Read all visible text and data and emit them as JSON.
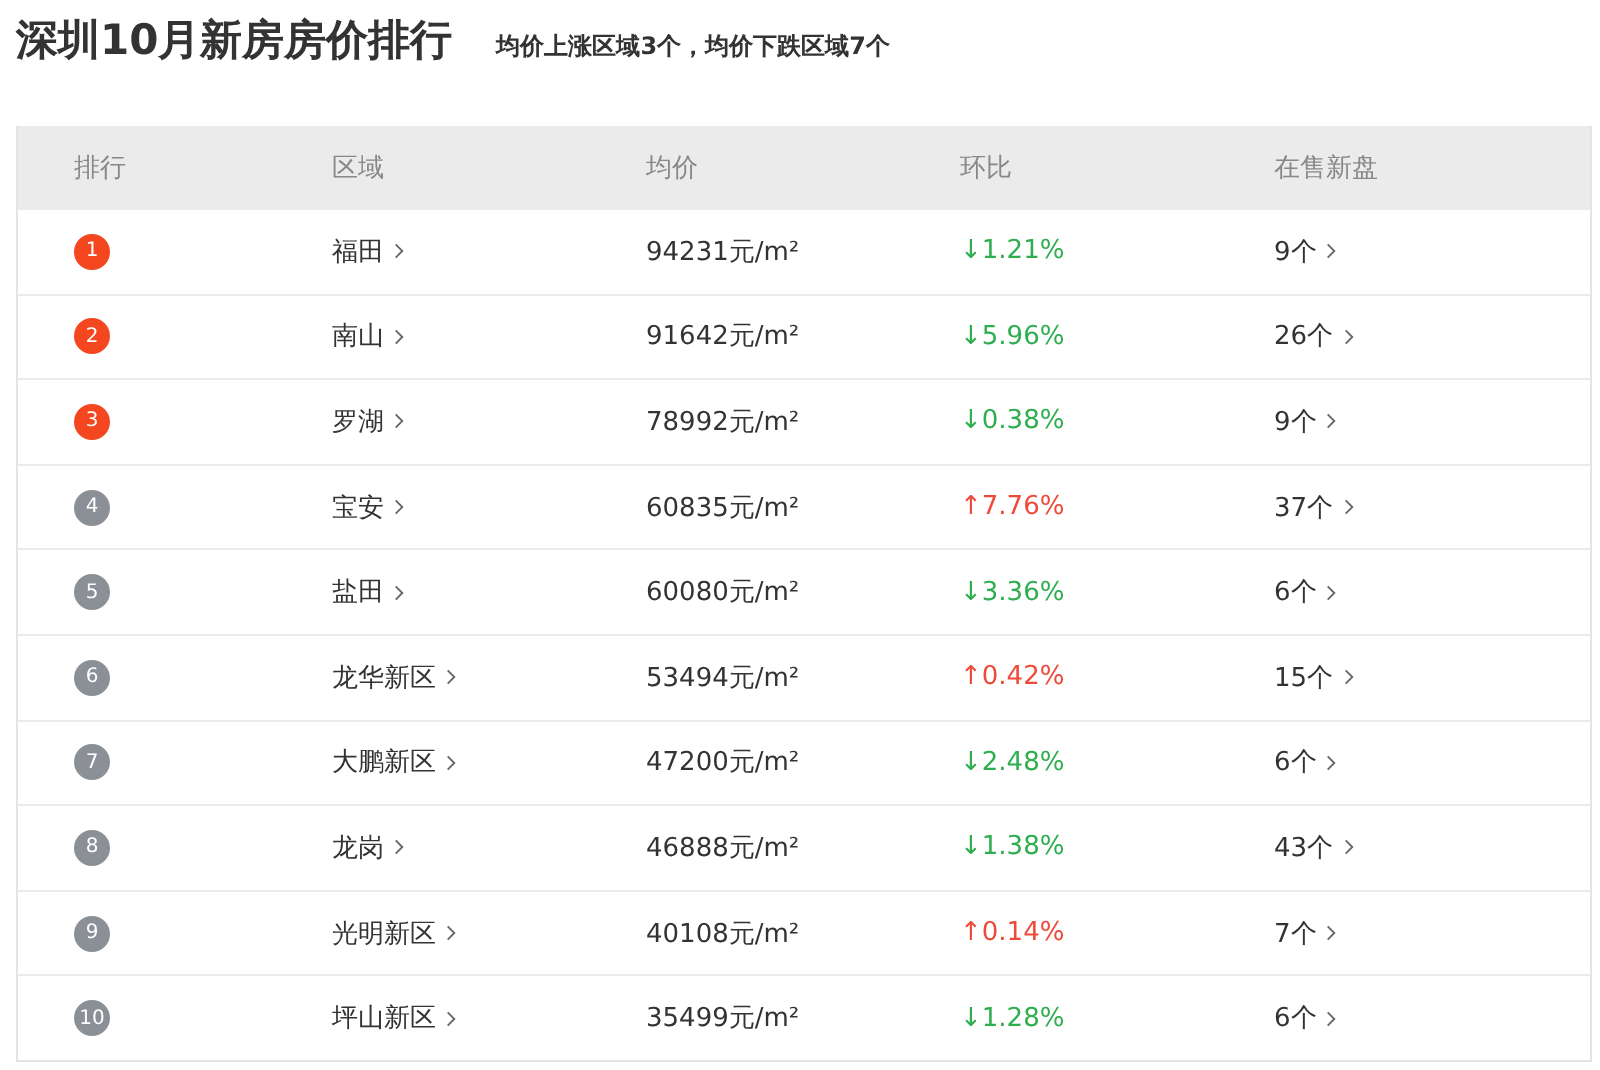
{
  "header": {
    "title": "深圳10月新房房价排行",
    "summary": "均价上涨区域3个，均价下跌区域7个"
  },
  "table": {
    "columns": [
      "排行",
      "区域",
      "均价",
      "环比",
      "在售新盘"
    ],
    "rows": [
      {
        "rank": "1",
        "top": true,
        "area": "福田",
        "price": "94231元/m²",
        "change": "↓1.21%",
        "kind": "down",
        "listings": "9个"
      },
      {
        "rank": "2",
        "top": true,
        "area": "南山",
        "price": "91642元/m²",
        "change": "↓5.96%",
        "kind": "down",
        "listings": "26个"
      },
      {
        "rank": "3",
        "top": true,
        "area": "罗湖",
        "price": "78992元/m²",
        "change": "↓0.38%",
        "kind": "down",
        "listings": "9个"
      },
      {
        "rank": "4",
        "top": false,
        "area": "宝安",
        "price": "60835元/m²",
        "change": "↑7.76%",
        "kind": "up",
        "listings": "37个"
      },
      {
        "rank": "5",
        "top": false,
        "area": "盐田",
        "price": "60080元/m²",
        "change": "↓3.36%",
        "kind": "down",
        "listings": "6个"
      },
      {
        "rank": "6",
        "top": false,
        "area": "龙华新区",
        "price": "53494元/m²",
        "change": "↑0.42%",
        "kind": "up",
        "listings": "15个"
      },
      {
        "rank": "7",
        "top": false,
        "area": "大鹏新区",
        "price": "47200元/m²",
        "change": "↓2.48%",
        "kind": "down",
        "listings": "6个"
      },
      {
        "rank": "8",
        "top": false,
        "area": "龙岗",
        "price": "46888元/m²",
        "change": "↓1.38%",
        "kind": "down",
        "listings": "43个"
      },
      {
        "rank": "9",
        "top": false,
        "area": "光明新区",
        "price": "40108元/m²",
        "change": "↑0.14%",
        "kind": "up",
        "listings": "7个"
      },
      {
        "rank": "10",
        "top": false,
        "area": "坪山新区",
        "price": "35499元/m²",
        "change": "↓1.28%",
        "kind": "down",
        "listings": "6个"
      }
    ]
  }
}
